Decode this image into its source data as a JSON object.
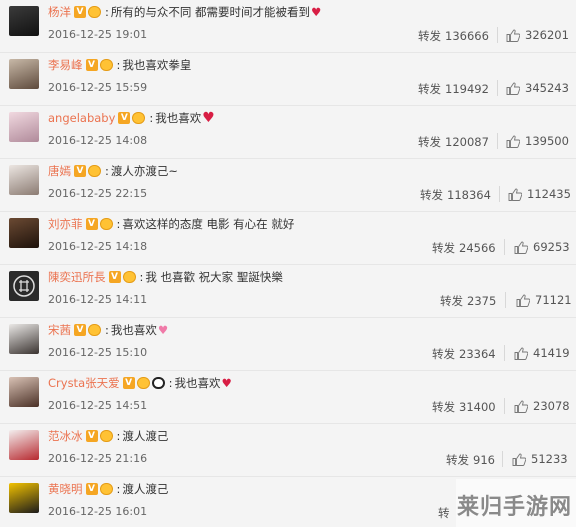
{
  "comments": [
    {
      "user": "杨洋",
      "crown": true,
      "text": "所有的与众不同 都需要时间才能被看到",
      "emoji": "heart",
      "date": "2016-12-25 19:01",
      "repost_label": "转发",
      "reposts": "136666",
      "likes": "326201"
    },
    {
      "user": "李易峰",
      "crown": true,
      "text": "我也喜欢拳皇",
      "emoji": "",
      "date": "2016-12-25 15:59",
      "repost_label": "转发",
      "reposts": "119492",
      "likes": "345243"
    },
    {
      "user": "angelababy",
      "crown": true,
      "text": "我也喜欢",
      "emoji": "heart",
      "date": "2016-12-25 14:08",
      "repost_label": "转发",
      "reposts": "120087",
      "likes": "139500"
    },
    {
      "user": "唐嫣",
      "crown": true,
      "text": "渡人亦渡己~",
      "emoji": "",
      "date": "2016-12-25 22:15",
      "repost_label": "转发",
      "reposts": "118364",
      "likes": "112435"
    },
    {
      "user": "刘亦菲",
      "crown": true,
      "text": "喜欢这样的态度 电影 有心在 就好",
      "emoji": "",
      "date": "2016-12-25 14:18",
      "repost_label": "转发",
      "reposts": "24566",
      "likes": "69253"
    },
    {
      "user": "陳奕迅所長",
      "crown": true,
      "text": "我 也喜歡 祝大家 聖誕快樂",
      "emoji": "",
      "date": "2016-12-25 14:11",
      "repost_label": "转发",
      "reposts": "2375",
      "likes": "71121"
    },
    {
      "user": "宋茜",
      "crown": true,
      "text": "我也喜欢",
      "emoji": "pink-heart",
      "date": "2016-12-25 15:10",
      "repost_label": "转发",
      "reposts": "23364",
      "likes": "41419"
    },
    {
      "user": "Crysta张天爱",
      "crown": true,
      "panda": true,
      "text": "我也喜欢",
      "emoji": "heart",
      "date": "2016-12-25 14:51",
      "repost_label": "转发",
      "reposts": "31400",
      "likes": "23078"
    },
    {
      "user": "范冰冰",
      "crown": true,
      "text": "渡人渡己",
      "emoji": "",
      "date": "2016-12-25 21:16",
      "repost_label": "转发",
      "reposts": "916",
      "likes": "51233"
    },
    {
      "user": "黄晓明",
      "crown": true,
      "text": "渡人渡己",
      "emoji": "",
      "date": "2016-12-25 16:01",
      "repost_label": "转发",
      "reposts": "",
      "likes": ""
    }
  ],
  "badge_letter": "V",
  "last_row_repost_partial": "转",
  "watermark": "莱归手游网",
  "colors": {
    "username": "#eb7350",
    "heart": "#d81e44",
    "pink_heart": "#f07aa8",
    "badge": "#f5a623"
  }
}
